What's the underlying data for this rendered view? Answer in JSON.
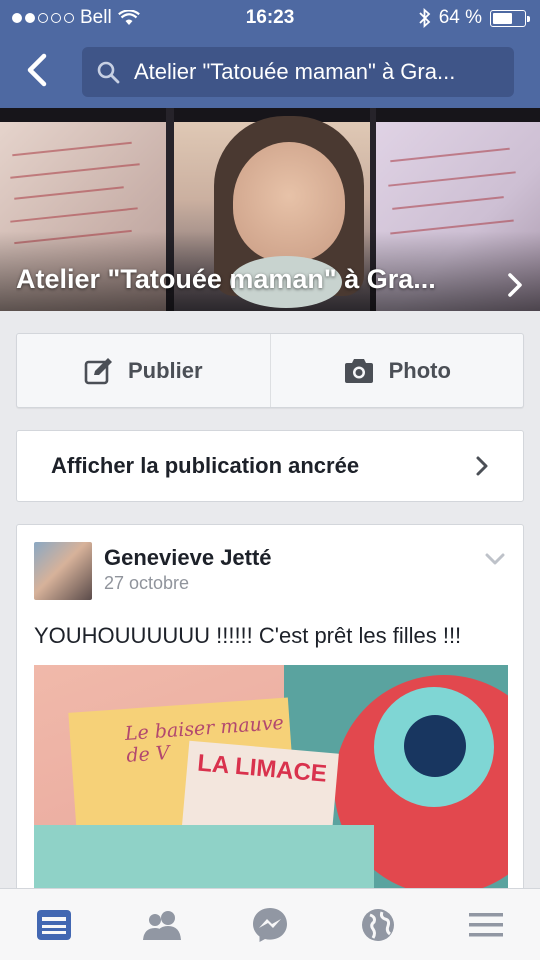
{
  "status": {
    "carrier": "Bell",
    "time": "16:23",
    "battery": "64 %",
    "battery_level": 0.64
  },
  "header": {
    "search_text": "Atelier \"Tatouée maman\" à Gra..."
  },
  "cover": {
    "title": "Atelier \"Tatouée maman\" à Gra..."
  },
  "actions": {
    "publish_label": "Publier",
    "photo_label": "Photo"
  },
  "pinned": {
    "label": "Afficher la publication ancrée"
  },
  "post": {
    "author": "Genevieve Jetté",
    "date": "27 octobre",
    "message": "YOUHOUUUUUU !!!!!! C'est prêt les filles !!!",
    "image_text_1": "Le baiser mauve de V",
    "image_text_2": "LA LIMACE"
  },
  "tabbar": {
    "active_color": "#4267b2",
    "inactive_color": "#9197a3",
    "icons": [
      "news-feed-icon",
      "friends-icon",
      "messenger-icon",
      "globe-icon",
      "menu-icon"
    ]
  }
}
